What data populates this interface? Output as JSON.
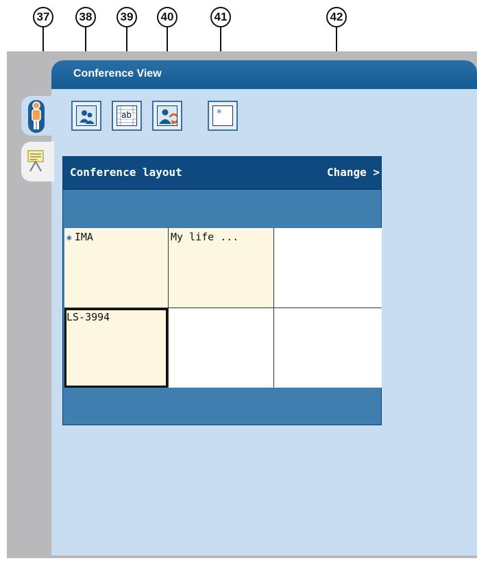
{
  "callouts": [
    "37",
    "38",
    "39",
    "40",
    "41",
    "42"
  ],
  "panel": {
    "title": "Conference View"
  },
  "side_tabs": [
    {
      "icon": "person-icon",
      "active": true
    },
    {
      "icon": "presentation-icon",
      "active": false
    }
  ],
  "toolbar": [
    {
      "icon": "participant-icon"
    },
    {
      "icon": "text-grid-icon",
      "text": "ab"
    },
    {
      "icon": "participant-refresh-icon"
    },
    {
      "icon": "star-window-icon",
      "text": "*"
    }
  ],
  "layout": {
    "title": "Conference layout",
    "change_label": "Change >",
    "cells": [
      {
        "label": "IMA",
        "marked": true
      },
      {
        "label": "My life ..."
      },
      {
        "label": ""
      },
      {
        "label": "LS-3994"
      },
      {
        "label": ""
      },
      {
        "label": ""
      }
    ]
  },
  "colors": {
    "header_blue": "#145a93",
    "panel_bg": "#c8ddf1",
    "layout_header": "#0e4a7f",
    "layout_band": "#3f7faf",
    "filled_cell": "#fdf6e1",
    "frame_grey": "#b9b9bb"
  }
}
